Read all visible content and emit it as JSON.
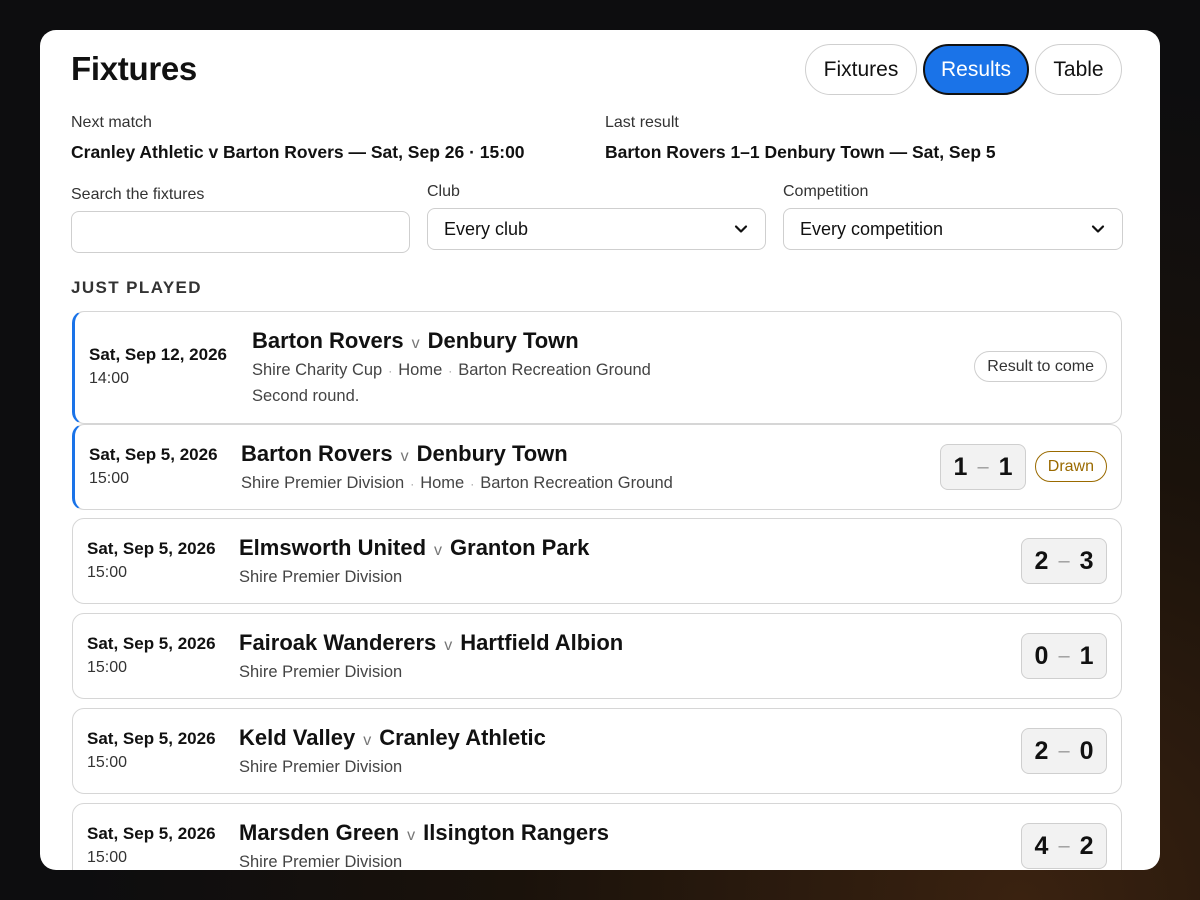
{
  "page": {
    "title": "Fixtures"
  },
  "tabs": [
    {
      "label": "Fixtures",
      "active": false
    },
    {
      "label": "Results",
      "active": true
    },
    {
      "label": "Table",
      "active": false
    }
  ],
  "summary": {
    "next_label": "Next match",
    "next_value": "Cranley Athletic v Barton Rovers — Sat, Sep 26 · 15:00",
    "last_label": "Last result",
    "last_value": "Barton Rovers 1–1 Denbury Town — Sat, Sep 5"
  },
  "filters": {
    "search_label": "Search the fixtures",
    "search_value": "",
    "club_label": "Club",
    "club_value": "Every club",
    "competition_label": "Competition",
    "competition_value": "Every competition"
  },
  "section": {
    "title": "JUST PLAYED"
  },
  "matches": [
    {
      "date": "Sat, Sep 12, 2026",
      "time": "14:00",
      "home": "Barton Rovers",
      "away": "Denbury Town",
      "v": "v",
      "competition": "Shire Charity Cup",
      "venue_type": "Home",
      "ground": "Barton Recreation Ground",
      "note": "Second round.",
      "status": "Result to come"
    },
    {
      "date": "Sat, Sep 5, 2026",
      "time": "15:00",
      "home": "Barton Rovers",
      "away": "Denbury Town",
      "v": "v",
      "competition": "Shire Premier Division",
      "venue_type": "Home",
      "ground": "Barton Recreation Ground",
      "home_score": "1",
      "away_score": "1",
      "dash": "–",
      "outcome": "Drawn"
    },
    {
      "date": "Sat, Sep 5, 2026",
      "time": "15:00",
      "home": "Elmsworth United",
      "away": "Granton Park",
      "v": "v",
      "competition": "Shire Premier Division",
      "home_score": "2",
      "away_score": "3",
      "dash": "–"
    },
    {
      "date": "Sat, Sep 5, 2026",
      "time": "15:00",
      "home": "Fairoak Wanderers",
      "away": "Hartfield Albion",
      "v": "v",
      "competition": "Shire Premier Division",
      "home_score": "0",
      "away_score": "1",
      "dash": "–"
    },
    {
      "date": "Sat, Sep 5, 2026",
      "time": "15:00",
      "home": "Keld Valley",
      "away": "Cranley Athletic",
      "v": "v",
      "competition": "Shire Premier Division",
      "home_score": "2",
      "away_score": "0",
      "dash": "–"
    },
    {
      "date": "Sat, Sep 5, 2026",
      "time": "15:00",
      "home": "Marsden Green",
      "away": "Ilsington Rangers",
      "v": "v",
      "competition": "Shire Premier Division",
      "home_score": "4",
      "away_score": "2",
      "dash": "–"
    }
  ],
  "colors": {
    "accent": "#1a73e8",
    "drawn": "#9a6a00"
  },
  "icons": {
    "select_arrow": "chevron-down-icon"
  }
}
